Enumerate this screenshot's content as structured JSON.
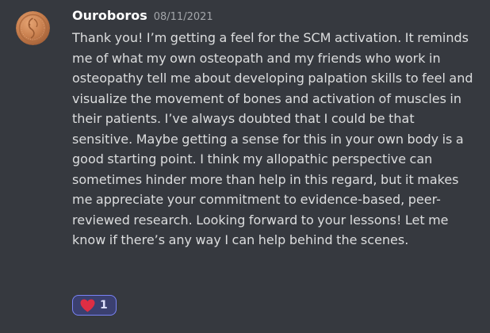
{
  "message": {
    "author": "Ouroboros",
    "timestamp": "08/11/2021",
    "text": "Thank you! I’m getting a feel for the SCM activation. It reminds me of what my own osteopath and my friends who work in osteopathy tell me about developing palpation skills to feel and visualize the movement of bones and activation of muscles in their patients. I’ve always doubted that I could be that sensitive. Maybe getting a sense for this in your own body is a good starting point. I think my allopathic perspective can sometimes hinder more than help in this regard, but it makes me appreciate your commitment to evidence-based, peer-reviewed research. Looking forward to your lessons! Let me know if there’s any way I can help behind the scenes.",
    "avatar_icon": "ouroboros-coin-avatar",
    "reactions": [
      {
        "emoji_icon": "red-heart-icon",
        "count": "1",
        "active": true
      }
    ]
  },
  "colors": {
    "background": "#36393f",
    "username": "#ffffff",
    "timestamp": "#a3a6aa",
    "text": "#dcddde",
    "reaction_bg": "#3b4070",
    "reaction_border": "#7983f5",
    "heart": "#dd2e44"
  }
}
